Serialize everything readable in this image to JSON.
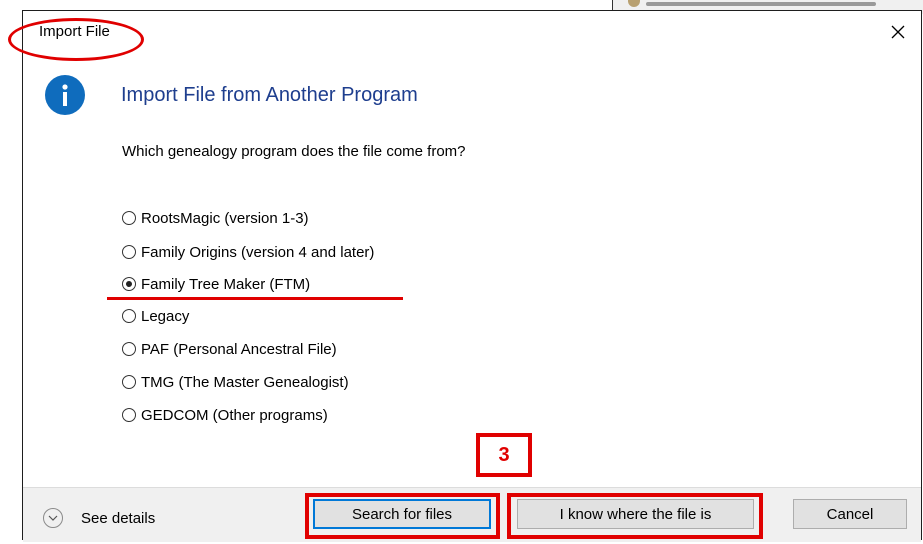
{
  "dialog": {
    "title": "Import File",
    "heading": "Import File from Another Program",
    "question": "Which genealogy program does the file come from?",
    "options": [
      {
        "label": "RootsMagic (version 1-3)",
        "selected": false
      },
      {
        "label": "Family Origins (version 4 and later)",
        "selected": false
      },
      {
        "label": "Family Tree Maker (FTM)",
        "selected": true
      },
      {
        "label": "Legacy",
        "selected": false
      },
      {
        "label": "PAF (Personal Ancestral File)",
        "selected": false
      },
      {
        "label": "TMG (The Master Genealogist)",
        "selected": false
      },
      {
        "label": "GEDCOM (Other programs)",
        "selected": false
      }
    ]
  },
  "footer": {
    "details_label": "See details",
    "search_label": "Search for files",
    "know_label": "I know where the file is",
    "cancel_label": "Cancel"
  },
  "annotation": {
    "step_number": "3",
    "color": "#e00000"
  },
  "icons": {
    "info": "info-icon",
    "close": "close-icon",
    "details": "chevron-down-icon"
  },
  "colors": {
    "heading": "#1e3e8e",
    "info_icon": "#0f6cbd",
    "default_button_border": "#0078d7"
  }
}
